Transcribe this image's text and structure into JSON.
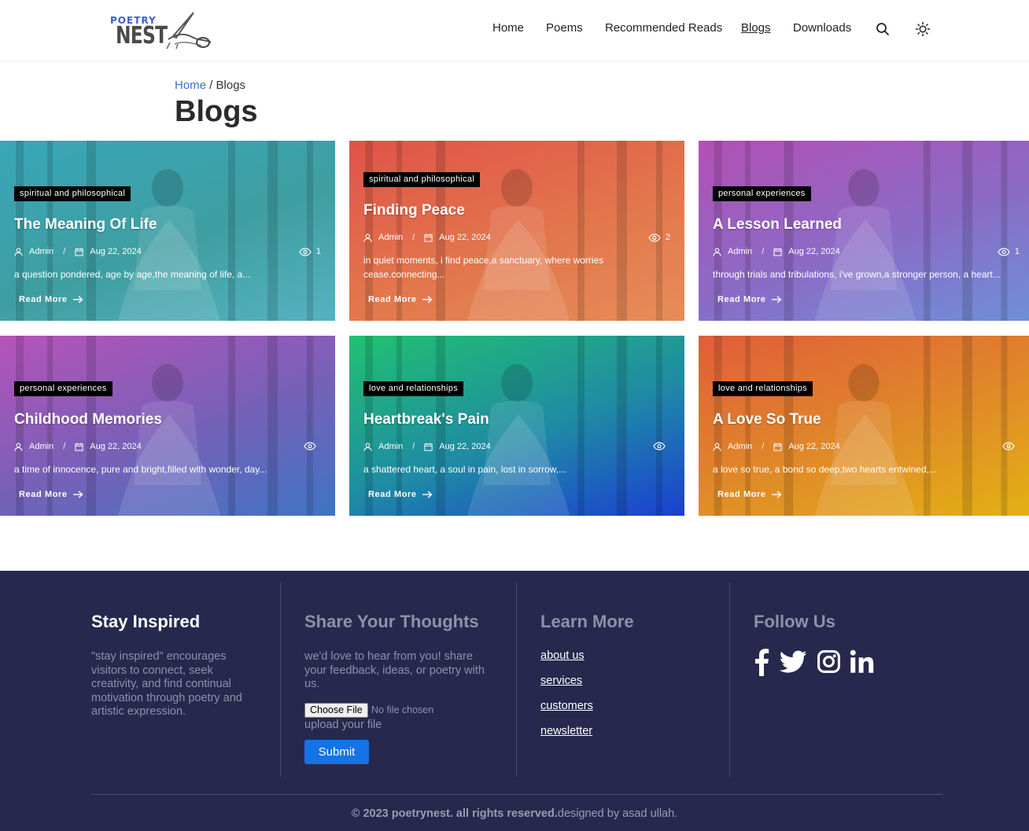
{
  "brand": {
    "logo_top": "POETRY",
    "logo_main": "NEST"
  },
  "nav": {
    "items": [
      "Home",
      "Poems",
      "Recommended Reads",
      "Blogs",
      "Downloads"
    ],
    "active": "Blogs",
    "search_icon": "search-icon",
    "theme_icon": "sun-icon"
  },
  "breadcrumb": {
    "home": "Home",
    "separator": " / ",
    "current": "Blogs"
  },
  "page_title": "Blogs",
  "cards": [
    {
      "category": "spiritual and philosophical",
      "title": "The Meaning Of Life",
      "author": "Admin",
      "date": "Aug 22, 2024",
      "views": "1",
      "excerpt": "a question pondered, age by age,the meaning of life, a...",
      "read_more": "Read More",
      "colors": [
        "#38a7b8",
        "#3f9ea1",
        "#55b2c0"
      ]
    },
    {
      "category": "spiritual and philosophical",
      "title": "Finding Peace",
      "author": "Admin",
      "date": "Aug 22, 2024",
      "views": "2",
      "excerpt": "in quiet moments, i find peace,a sanctuary, where worries cease.connecting...",
      "read_more": "Read More",
      "colors": [
        "#e0534a",
        "#e2764c",
        "#e68d58"
      ]
    },
    {
      "category": "personal experiences",
      "title": "A Lesson Learned",
      "author": "Admin",
      "date": "Aug 22, 2024",
      "views": "1",
      "excerpt": "through trials and tribulations, i've grown,a stronger person, a heart...",
      "read_more": "Read More",
      "colors": [
        "#b350b4",
        "#8a6bc6",
        "#6f8fd8"
      ]
    },
    {
      "category": "personal experiences",
      "title": "Childhood Memories",
      "author": "Admin",
      "date": "Aug 22, 2024",
      "views": "",
      "excerpt": "a time of innocence, pure and bright,filled with wonder, day...",
      "read_more": "Read More",
      "colors": [
        "#b653b8",
        "#7561b8",
        "#3f74c3"
      ]
    },
    {
      "category": "love and relationships",
      "title": "Heartbreak's Pain",
      "author": "Admin",
      "date": "Aug 22, 2024",
      "views": "",
      "excerpt": "a shattered heart, a soul in pain, lost in sorrow,...",
      "read_more": "Read More",
      "colors": [
        "#21c170",
        "#1f8aa5",
        "#1b3fd2"
      ]
    },
    {
      "category": "love and relationships",
      "title": "A Love So True",
      "author": "Admin",
      "date": "Aug 22, 2024",
      "views": "",
      "excerpt": "a love so true, a bond so deep,two hearts entwined,...",
      "read_more": "Read More",
      "colors": [
        "#e15d3a",
        "#e08a28",
        "#e3b113"
      ]
    }
  ],
  "footer": {
    "col1": {
      "heading": "Stay Inspired",
      "text": "\"stay inspired\" encourages visitors to connect, seek creativity, and find continual motivation through poetry and artistic expression."
    },
    "col2": {
      "heading": "Share Your Thoughts",
      "text": "we'd love to hear from you! share your feedback, ideas, or poetry with us.",
      "file_button": "Choose File",
      "file_status": "No file chosen",
      "upload_label": "upload your file",
      "submit": "Submit"
    },
    "col3": {
      "heading": "Learn More",
      "links": [
        "about us",
        "services",
        "customers",
        "newsletter"
      ]
    },
    "col4": {
      "heading": "Follow Us",
      "icons": [
        "facebook-icon",
        "twitter-icon",
        "instagram-icon",
        "linkedin-icon"
      ]
    },
    "copyright_bold": "© 2023 poetrynest. all rights reserved.",
    "copyright_rest": "designed by asad ullah."
  }
}
